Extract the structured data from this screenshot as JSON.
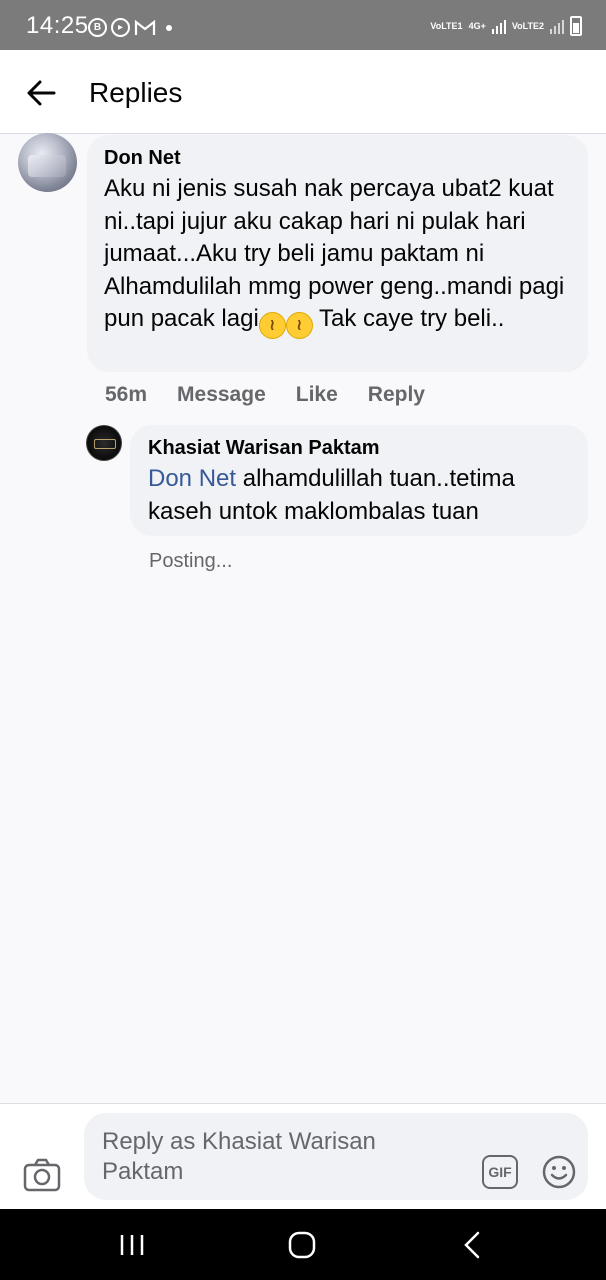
{
  "status_bar": {
    "time": "14:25",
    "network_labels": [
      "VoLTE1",
      "4G+",
      "VoLTE2"
    ]
  },
  "header": {
    "title": "Replies",
    "back_icon": "arrow-left-icon"
  },
  "comment": {
    "author": "Don Net",
    "text_before_emoji": "Aku ni jenis susah nak percaya ubat2 kuat ni..tapi jujur aku cakap hari ni pulak hari jumaat...Aku try beli jamu paktam ni Alhamdulilah mmg power geng..mandi pagi pun pacak lagi",
    "emojis": [
      "laughing-face-emoji",
      "laughing-face-emoji"
    ],
    "text_after_emoji": " Tak caye try beli..",
    "time_ago": "56m",
    "actions": [
      "Message",
      "Like",
      "Reply"
    ]
  },
  "reply": {
    "author": "Khasiat Warisan Paktam",
    "mention": "Don Net",
    "text": " alhamdulillah tuan..tetima kaseh untok maklombalas tuan",
    "status": "Posting..."
  },
  "composer": {
    "placeholder": "Reply as Khasiat Warisan Paktam",
    "gif_label": "GIF",
    "camera_icon": "camera-icon",
    "emoji_icon": "smiley-icon"
  },
  "colors": {
    "mention": "#385898",
    "bubble": "#f0f2f5",
    "status_bar": "#7b7b7b",
    "secondary_text": "#65676b"
  }
}
